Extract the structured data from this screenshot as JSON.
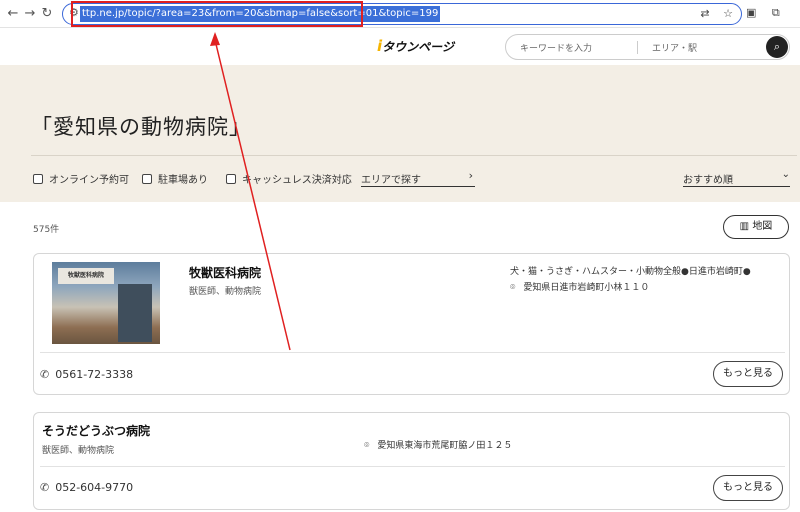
{
  "browser": {
    "url": "ttp.ne.jp/topic/?area=23&from=20&sbmap=false&sort=01&topic=199"
  },
  "header": {
    "logo": "タウンページ",
    "keyword_placeholder": "キーワードを入力",
    "area_placeholder": "エリア・駅"
  },
  "banner": {
    "title": "「愛知県の動物病院」",
    "filters": [
      "オンライン予約可",
      "駐車場あり",
      "キャッシュレス決済対応"
    ],
    "area_search": "エリアで探す",
    "sort": "おすすめ順"
  },
  "results": {
    "count": "575件",
    "map_label": "地図",
    "items": [
      {
        "name": "牧獣医科病院",
        "category": "獣医師、動物病院",
        "description": "犬・猫・うさぎ・ハムスター・小動物全般●日進市岩崎町●",
        "address": "愛知県日進市岩崎町小林１１０",
        "phone": "0561-72-3338",
        "more": "もっと見る",
        "image_sign": "牧獣医科病院"
      },
      {
        "name": "そうだどうぶつ病院",
        "category": "獣医師、動物病院",
        "address": "愛知県東海市荒尾町脇ノ田１２５",
        "phone": "052-604-9770",
        "more": "もっと見る"
      }
    ]
  },
  "annotation": {
    "color": "#e02020"
  }
}
